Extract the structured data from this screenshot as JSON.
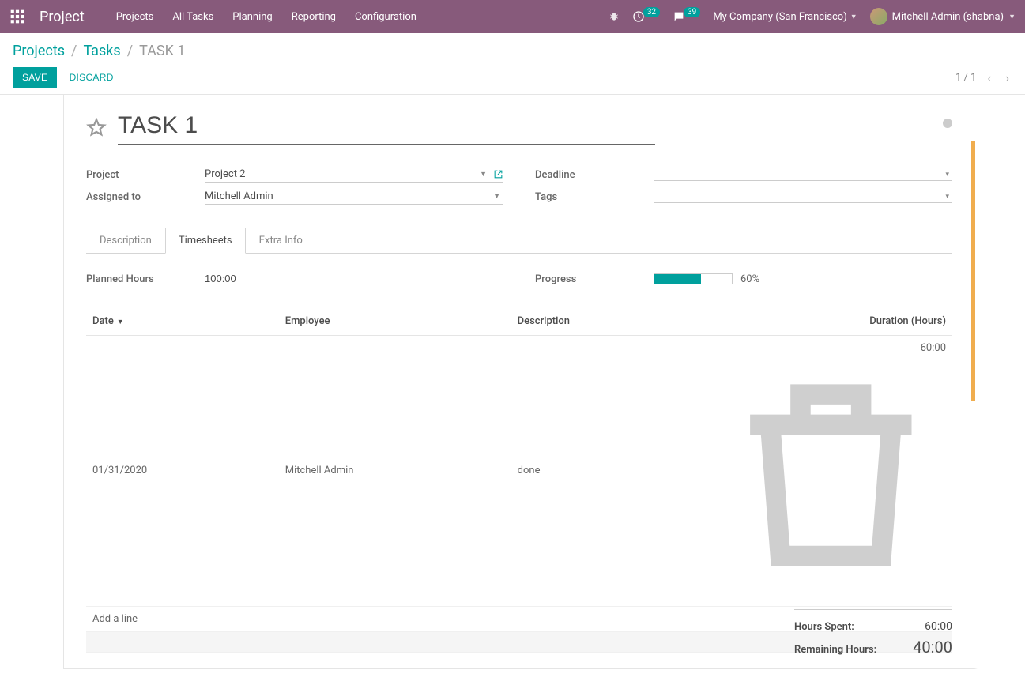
{
  "navbar": {
    "brand": "Project",
    "menu": [
      "Projects",
      "All Tasks",
      "Planning",
      "Reporting",
      "Configuration"
    ],
    "badge1_count": "32",
    "badge2_count": "39",
    "company": "My Company (San Francisco)",
    "user": "Mitchell Admin (shabna)"
  },
  "breadcrumbs": {
    "items": [
      "Projects",
      "Tasks"
    ],
    "current": "TASK 1"
  },
  "buttons": {
    "save": "Save",
    "discard": "Discard"
  },
  "pager": {
    "text": "1 / 1"
  },
  "task": {
    "title": "TASK 1",
    "fields": {
      "project_label": "Project",
      "project_value": "Project 2",
      "assigned_label": "Assigned to",
      "assigned_value": "Mitchell Admin",
      "deadline_label": "Deadline",
      "deadline_value": "",
      "tags_label": "Tags",
      "tags_value": ""
    },
    "tabs": [
      "Description",
      "Timesheets",
      "Extra Info"
    ],
    "planned_hours_label": "Planned Hours",
    "planned_hours_value": "100:00",
    "progress_label": "Progress",
    "progress_pct": 60,
    "progress_text": "60%",
    "table": {
      "headers": {
        "date": "Date",
        "employee": "Employee",
        "description": "Description",
        "duration": "Duration (Hours)"
      },
      "rows": [
        {
          "date": "01/31/2020",
          "employee": "Mitchell Admin",
          "description": "done",
          "duration": "60:00"
        }
      ],
      "add_line": "Add a line"
    },
    "totals": {
      "spent_label": "Hours Spent:",
      "spent_value": "60:00",
      "remain_label": "Remaining Hours:",
      "remain_value": "40:00"
    }
  }
}
